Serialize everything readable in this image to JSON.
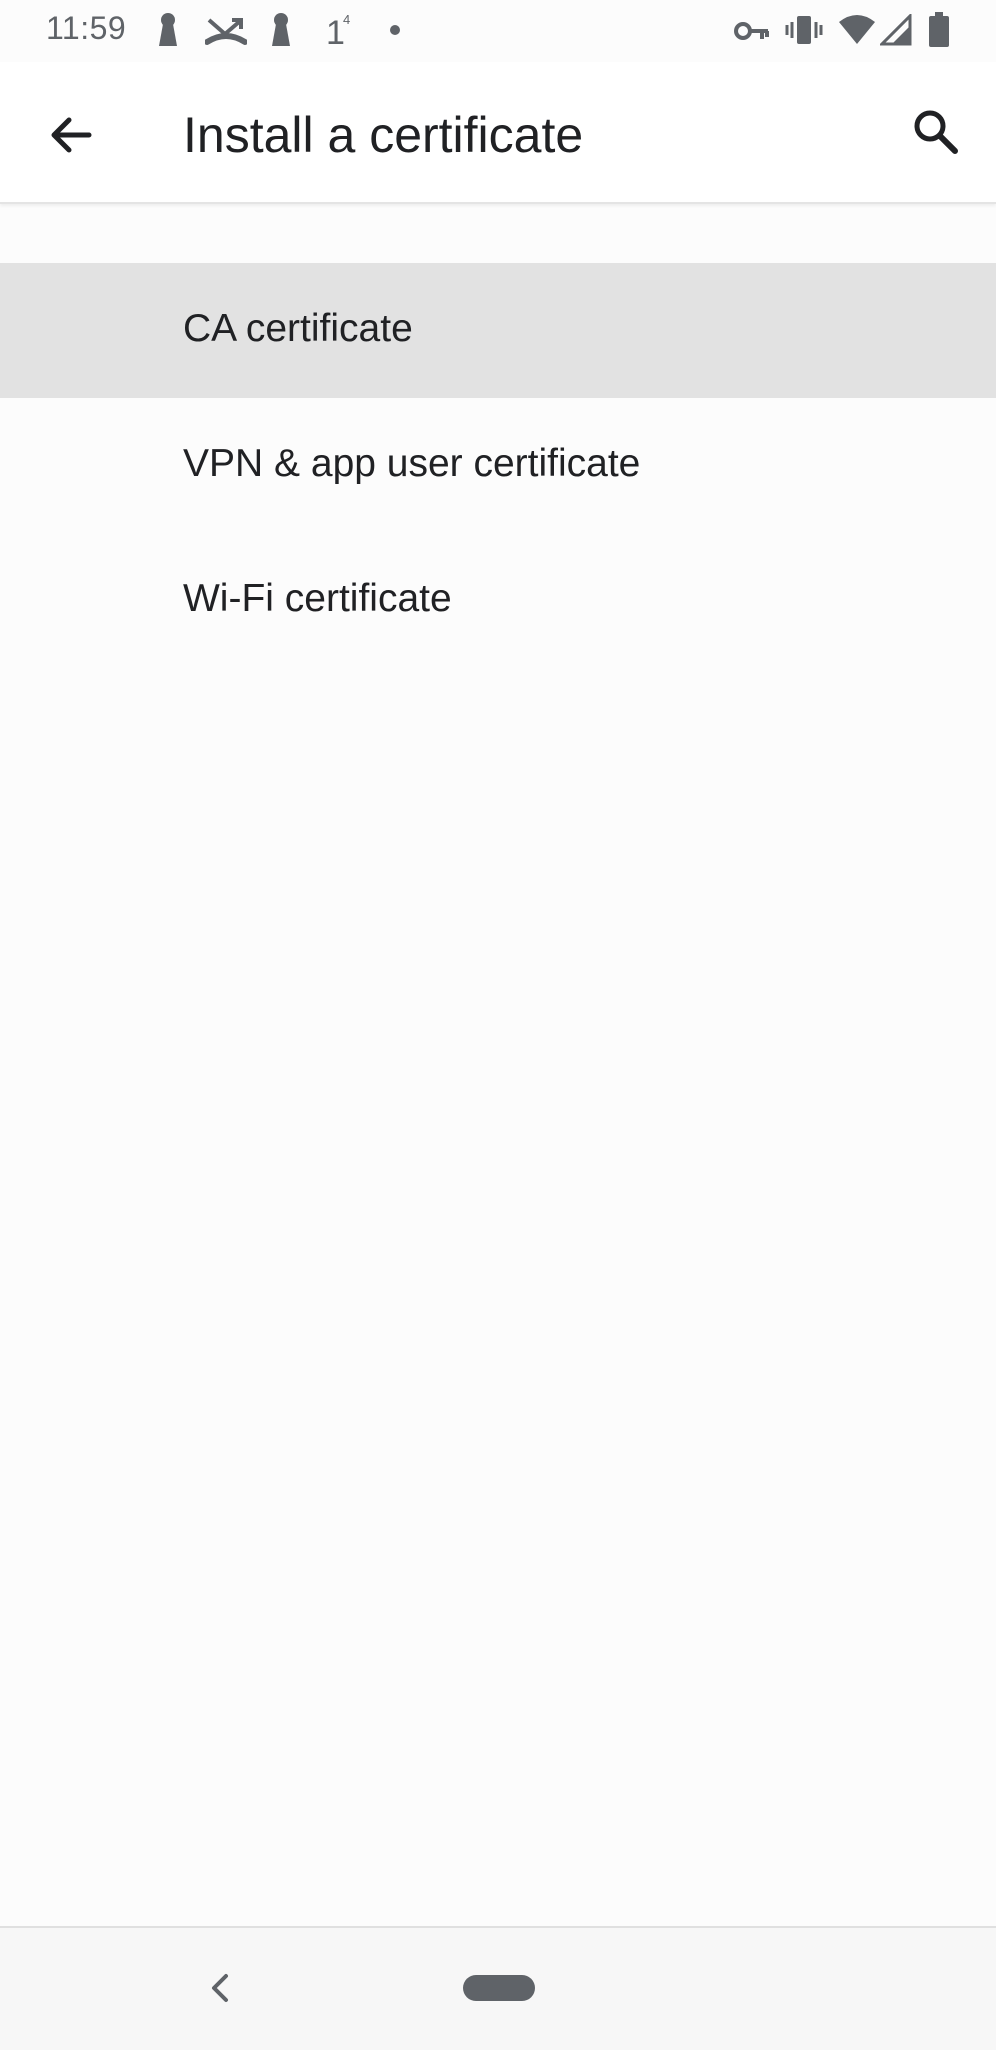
{
  "status_bar": {
    "time": "11:59",
    "left_icons": [
      "keyhole-icon",
      "missed-call-icon",
      "keyhole-icon",
      "signal-icon",
      "dot-icon"
    ],
    "right_icons": [
      "vpn-key-icon",
      "vibrate-icon",
      "wifi-icon",
      "cell-signal-icon",
      "battery-icon"
    ]
  },
  "app_bar": {
    "title": "Install a certificate",
    "back_icon": "arrow-back-icon",
    "search_icon": "search-icon"
  },
  "list": {
    "items": [
      {
        "label": "CA certificate",
        "selected": true
      },
      {
        "label": "VPN & app user certificate",
        "selected": false
      },
      {
        "label": "Wi-Fi certificate",
        "selected": false
      }
    ]
  },
  "nav_bar": {
    "back_icon": "nav-back-chevron-icon",
    "home_icon": "home-pill-icon"
  }
}
